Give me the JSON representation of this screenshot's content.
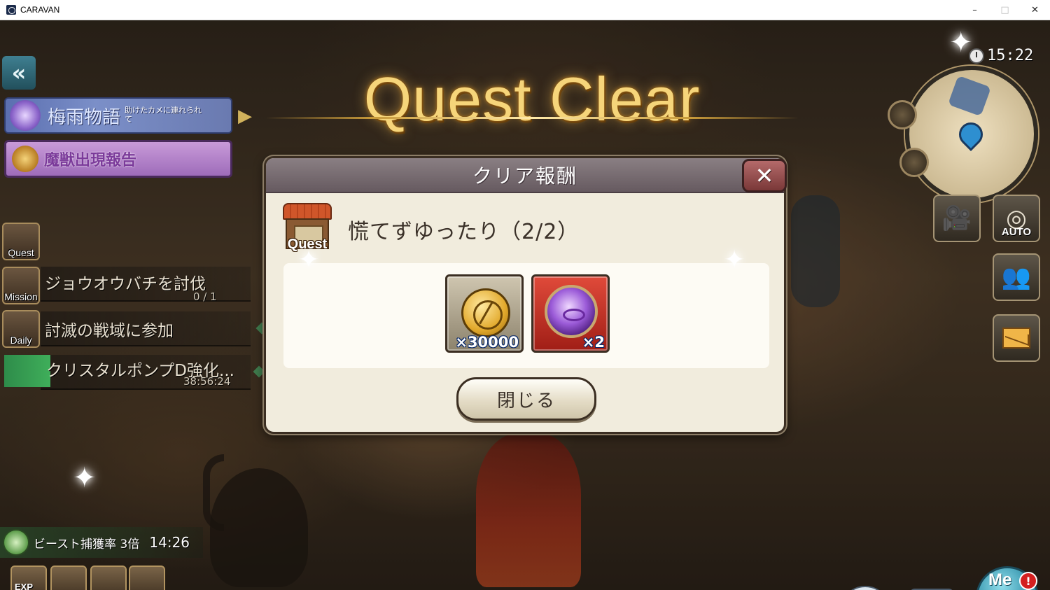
{
  "window": {
    "title": "CARAVAN",
    "minimize": "–",
    "maximize": "□",
    "close": "✕"
  },
  "banner": {
    "title": "Quest Clear"
  },
  "left_panel": {
    "back": "«",
    "event_title": "梅雨物語",
    "event_subtitle": "助けたカメに連れられて",
    "beast_report": "魔獣出現報告",
    "items": [
      {
        "icon_label": "Quest"
      },
      {
        "icon_label": "Mission",
        "text": "ジョウオウバチを討伐",
        "sub": "0 / 1"
      },
      {
        "icon_label": "Daily",
        "text": "討滅の戦域に参加"
      },
      {
        "text": "クリスタルポンプD強化...",
        "sub": "38:56:24"
      }
    ]
  },
  "status": {
    "beast_rate": "ビースト捕獲率 3倍",
    "beast_rate_time": "14:26",
    "bottom_icons": [
      {
        "label": "EXP"
      },
      {
        "label": ""
      },
      {
        "label": ""
      },
      {
        "label": ""
      }
    ]
  },
  "right_panel": {
    "clock": "15:22",
    "auto_label": "AUTO",
    "menu_label": "Me",
    "menu_badge": "!",
    "chat_label": "…"
  },
  "dialog": {
    "title": "クリア報酬",
    "close_icon": "✕",
    "quest_icon_label": "Quest",
    "quest_name": "慌てずゆったり（2/2）",
    "rewards": [
      {
        "icon": "gil-coin-icon",
        "quantity": "×30000"
      },
      {
        "icon": "purple-crystal-icon",
        "quantity": "×2"
      }
    ],
    "close_button": "閉じる"
  }
}
